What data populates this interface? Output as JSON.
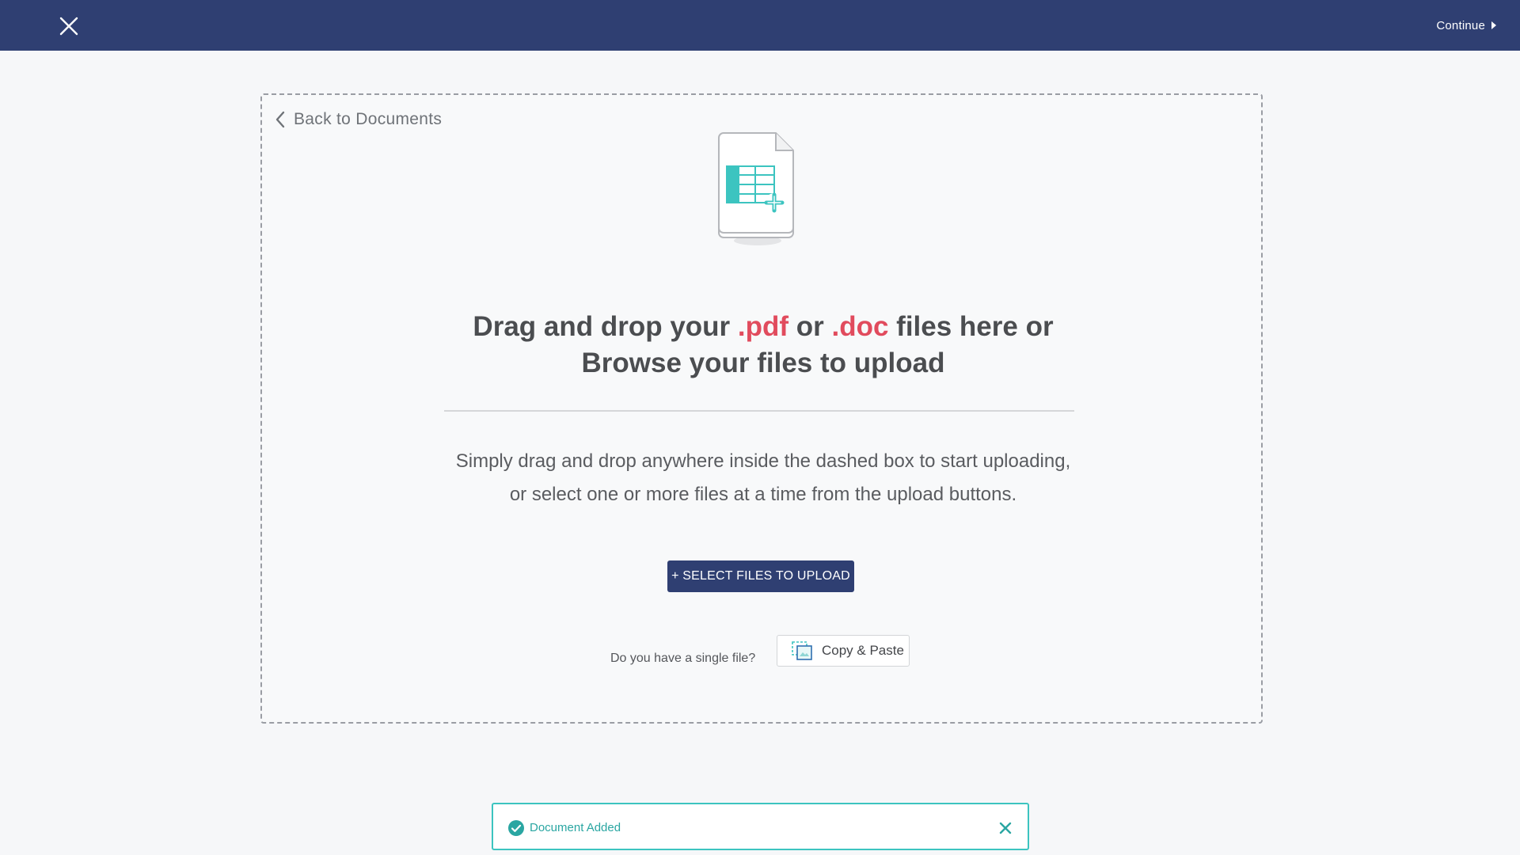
{
  "header": {
    "close_icon": "close-icon",
    "continue_label": "Continue",
    "continue_icon": "caret-right-icon",
    "background": "#2f3f72"
  },
  "dropzone": {
    "back_label": "Back to Documents",
    "back_icon": "chevron-left-icon",
    "illustration_icon": "spreadsheet-document-add-icon",
    "headline": {
      "part1": "Drag and drop your ",
      "ext1": ".pdf",
      "part2": " or ",
      "ext2": ".doc",
      "part3": " files here or",
      "line2": "Browse your files to upload"
    },
    "description_line1": "Simply drag and drop anywhere inside the dashed box to start uploading,",
    "description_line2": "or select one or more files at a time from the upload buttons.",
    "select_button_label": "+ SELECT FILES TO UPLOAD",
    "single_file_prompt": "Do you have a single file?",
    "copy_paste_label": "Copy & Paste",
    "copy_paste_icon": "clipboard-icon"
  },
  "toast": {
    "message": "Document Added",
    "status_icon": "check-circle-icon",
    "dismiss_icon": "close-icon"
  },
  "colors": {
    "accent": "#e14b5d",
    "primary": "#2f3f72",
    "success": "#3cc4c0"
  }
}
